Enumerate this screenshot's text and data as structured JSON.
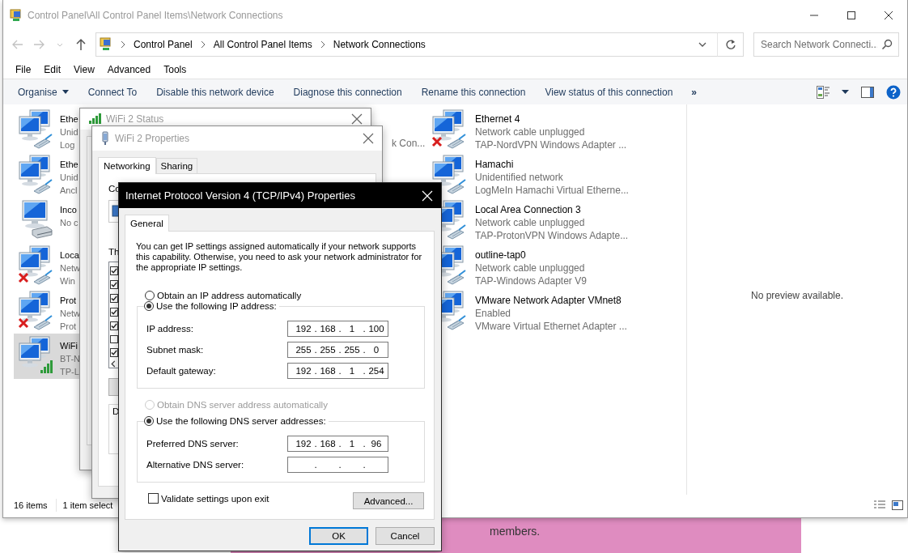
{
  "explorer": {
    "title": "Control Panel\\All Control Panel Items\\Network Connections",
    "breadcrumb": [
      "Control Panel",
      "All Control Panel Items",
      "Network Connections"
    ],
    "search": {
      "placeholder": "Search Network Connecti..."
    },
    "menu": [
      "File",
      "Edit",
      "View",
      "Advanced",
      "Tools"
    ],
    "commands": [
      {
        "label": "Organise",
        "dropdown": true
      },
      {
        "label": "Connect To",
        "dropdown": false
      },
      {
        "label": "Disable this network device",
        "dropdown": false
      },
      {
        "label": "Diagnose this connection",
        "dropdown": false
      },
      {
        "label": "Rename this connection",
        "dropdown": false
      },
      {
        "label": "View status of this connection",
        "dropdown": false
      }
    ],
    "more": "»",
    "connections_left": [
      {
        "name": "Ethe",
        "status": "Unid",
        "adapter": "Log",
        "kind": "cable",
        "disconnected": false,
        "selected": false
      },
      {
        "name": "Ethe",
        "status": "Unid",
        "adapter": "Ancl",
        "kind": "cable",
        "disconnected": false,
        "selected": false
      },
      {
        "name": "Inco",
        "status": "No c",
        "kind": "modem",
        "disconnected": false,
        "selected": false
      },
      {
        "name": "Loca",
        "status": "Netw",
        "adapter": "Win",
        "kind": "cable",
        "disconnected": true,
        "selected": false
      },
      {
        "name": "Prot",
        "status": "Netw",
        "adapter": "Prot",
        "kind": "cable",
        "disconnected": true,
        "selected": false
      },
      {
        "name": "WiFi",
        "status": "BT-N",
        "adapter": "TP-L",
        "kind": "wifi",
        "disconnected": false,
        "selected": true
      }
    ],
    "fragment": "k Con...",
    "connections_right": [
      {
        "name": "Ethernet 4",
        "status": "Network cable unplugged",
        "adapter": "TAP-NordVPN Windows Adapter ...",
        "kind": "cable",
        "disconnected": true,
        "selected": false
      },
      {
        "name": "Hamachi",
        "status": "Unidentified network",
        "adapter": "LogMeIn Hamachi Virtual Etherne...",
        "kind": "cable",
        "selected": false
      },
      {
        "name": "Local Area Connection 3",
        "status": "Network cable unplugged",
        "adapter": "TAP-ProtonVPN Windows Adapte...",
        "kind": "cable",
        "selected": false
      },
      {
        "name": "outline-tap0",
        "status": "Network cable unplugged",
        "adapter": "TAP-Windows Adapter V9",
        "kind": "cable",
        "selected": false
      },
      {
        "name": "VMware Network Adapter VMnet8",
        "status": "Enabled",
        "adapter": "VMware Virtual Ethernet Adapter ...",
        "kind": "cable",
        "selected": false
      }
    ],
    "preview": "No preview available.",
    "status_bar": {
      "count": "16 items",
      "selection": "1 item select"
    }
  },
  "status_dialog": {
    "title": "WiFi 2 Status"
  },
  "properties_dialog": {
    "title": "WiFi 2 Properties",
    "tabs": [
      {
        "label": "Networking",
        "selected": true
      },
      {
        "label": "Sharing",
        "selected": false
      }
    ],
    "connect_label": "Co",
    "items_label": "Th",
    "description_label": "D",
    "items": [
      {
        "checked": true
      },
      {
        "checked": true
      },
      {
        "checked": true
      },
      {
        "checked": true
      },
      {
        "checked": true
      },
      {
        "checked": false
      },
      {
        "checked": true
      }
    ]
  },
  "ipv4_dialog": {
    "title": "Internet Protocol Version 4 (TCP/IPv4) Properties",
    "tabs": [
      {
        "label": "General",
        "selected": true
      }
    ],
    "intro": "You can get IP settings assigned automatically if your network supports this capability. Otherwise, you need to ask your network administrator for the appropriate IP settings.",
    "separator": ".",
    "ip_options": [
      {
        "label": "Obtain an IP address automatically",
        "selected": false,
        "disabled": false
      },
      {
        "label": "Use the following IP address:",
        "selected": true,
        "disabled": false
      }
    ],
    "ip_fields": [
      {
        "label": "IP address:",
        "octets": [
          "192",
          "168",
          "1",
          "100"
        ]
      },
      {
        "label": "Subnet mask:",
        "octets": [
          "255",
          "255",
          "255",
          "0"
        ]
      },
      {
        "label": "Default gateway:",
        "octets": [
          "192",
          "168",
          "1",
          "254"
        ]
      }
    ],
    "dns_options": [
      {
        "label": "Obtain DNS server address automatically",
        "selected": false,
        "disabled": true
      },
      {
        "label": "Use the following DNS server addresses:",
        "selected": true,
        "disabled": false
      }
    ],
    "dns_fields": [
      {
        "label": "Preferred DNS server:",
        "octets": [
          "192",
          "168",
          "1",
          "96"
        ]
      },
      {
        "label": "Alternative DNS server:"
      }
    ],
    "validate": {
      "label": "Validate settings upon exit",
      "checked": false
    },
    "advanced": "Advanced...",
    "buttons": [
      {
        "label": "OK",
        "default": true
      },
      {
        "label": "Cancel",
        "default": false
      }
    ]
  },
  "background": {
    "text": "members."
  }
}
